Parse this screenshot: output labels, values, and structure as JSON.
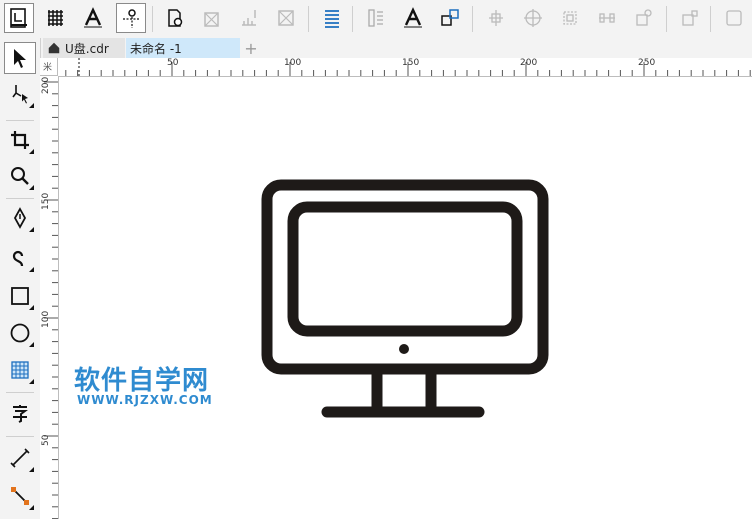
{
  "toolbar": {
    "buttons": [
      {
        "name": "page-setup-icon"
      },
      {
        "name": "grid-icon"
      },
      {
        "name": "text-a-icon"
      },
      {
        "name": "guidelines-icon"
      },
      {
        "name": "document-settings-icon"
      },
      {
        "name": "image-export-icon"
      },
      {
        "name": "align-distribute-icon"
      },
      {
        "name": "image-cross-icon"
      },
      {
        "name": "paragraph-lines-icon"
      },
      {
        "name": "text-columns-icon"
      },
      {
        "name": "text-a-icon"
      },
      {
        "name": "shape-overlap-icon"
      },
      {
        "name": "node-align-icon"
      },
      {
        "name": "target-icon"
      },
      {
        "name": "transform-icon"
      },
      {
        "name": "node-distribute-icon"
      },
      {
        "name": "copy-properties-icon"
      },
      {
        "name": "arrange-icon"
      }
    ]
  },
  "tabs": {
    "home_label": "U盘.cdr",
    "active_label": "未命名 -1",
    "add_label": "+"
  },
  "ruler": {
    "horizontal": [
      "50",
      "100",
      "150",
      "200",
      "250"
    ],
    "vertical": [
      "200",
      "150",
      "100",
      "50"
    ],
    "unit": "米"
  },
  "watermark": {
    "cn": "软件自学网",
    "en": "WWW.RJZXW.COM"
  },
  "colors": {
    "accent": "#3ea8cc",
    "watermark": "#2f8bd0",
    "drawing": "#1e1a18"
  }
}
